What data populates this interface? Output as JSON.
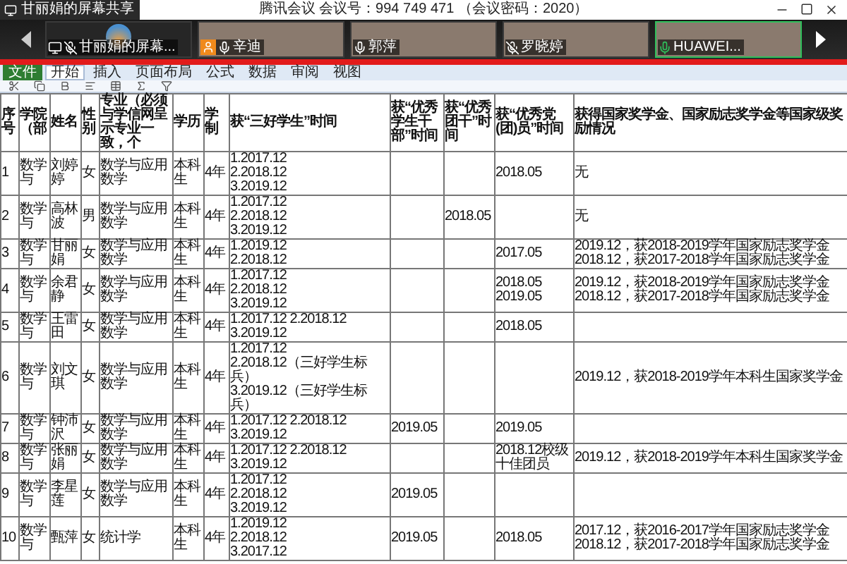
{
  "window": {
    "title": "腾讯会议 会议号：994 749 471 （会议密码：2020）"
  },
  "participants": [
    {
      "name": "甘丽娟的屏幕...",
      "kind": "screen",
      "muted": true,
      "speaking": false,
      "host": false
    },
    {
      "name": "辛迪",
      "kind": "video",
      "muted": false,
      "speaking": false,
      "host": true
    },
    {
      "name": "郭萍",
      "kind": "video",
      "muted": false,
      "speaking": false,
      "host": false
    },
    {
      "name": "罗晓婷",
      "kind": "video",
      "muted": true,
      "speaking": false,
      "host": false
    },
    {
      "name": "HUAWEI...",
      "kind": "video",
      "muted": false,
      "speaking": true,
      "host": false
    }
  ],
  "excel": {
    "tabs": [
      {
        "label": "文件",
        "kind": "file",
        "selected": false
      },
      {
        "label": "开始",
        "kind": "tab",
        "selected": true
      },
      {
        "label": "插入",
        "kind": "tab",
        "selected": false
      },
      {
        "label": "页面布局",
        "kind": "tab",
        "selected": false
      },
      {
        "label": "公式",
        "kind": "tab",
        "selected": false
      },
      {
        "label": "数据",
        "kind": "tab",
        "selected": false
      },
      {
        "label": "审阅",
        "kind": "tab",
        "selected": false
      },
      {
        "label": "视图",
        "kind": "tab",
        "selected": false
      }
    ],
    "table": {
      "columns": [
        "序号",
        "学院（部",
        "姓名",
        "性别",
        "专业（必须与学信网呈示专业一致，个",
        "学历",
        "学制",
        "获“三好学生”时间",
        "获“优秀学生干部”时间",
        "获“优秀团干”时间",
        "获“优秀党(团)员”时间",
        "获得国家奖学金、国家励志奖学金等国家级奖励情况"
      ],
      "rows": [
        [
          "1",
          "数学与",
          "刘婷婷",
          "女",
          "数学与应用数学",
          "本科生",
          "4年",
          "1.2017.12\n2.2018.12\n3.2019.12",
          null,
          null,
          "2018.05",
          "无"
        ],
        [
          "2",
          "数学与",
          "高林波",
          "男",
          "数学与应用数学",
          "本科生",
          "4年",
          "1.2017.12\n2.2018.12\n3.2019.12",
          null,
          "2018.05",
          null,
          "无"
        ],
        [
          "3",
          "数学与",
          "甘丽娟",
          "女",
          "数学与应用数学",
          "本科生",
          "4年",
          "1.2019.12\n2.2018.12",
          null,
          null,
          "2017.05",
          "2019.12，获2018-2019学年国家励志奖学金\n2018.12，获2017-2018学年国家励志奖学金"
        ],
        [
          "4",
          "数学与",
          "余君静",
          "女",
          "数学与应用数学",
          "本科生",
          "4年",
          "1.2017.12\n2.2018.12\n3.2019.12",
          null,
          null,
          "2018.05\n2019.05",
          "2019.12，获2018-2019学年国家励志奖学金\n2018.12，获2017-2018学年国家励志奖学金"
        ],
        [
          "5",
          "数学与",
          "王雷田",
          "女",
          "数学与应用数学",
          "本科生",
          "4年",
          "1.2017.12 2.2018.12\n3.2019.12",
          null,
          null,
          "2018.05",
          null
        ],
        [
          "6",
          "数学与",
          "刘文琪",
          "女",
          "数学与应用数学",
          "本科生",
          "4年",
          "1.2017.12\n2.2018.12（三好学生标兵）\n3.2019.12（三好学生标兵）",
          null,
          null,
          null,
          "2019.12，获2018-2019学年本科生国家奖学金"
        ],
        [
          "7",
          "数学与",
          "钟沛沢",
          "女",
          "数学与应用数学",
          "本科生",
          "4年",
          "1.2017.12 2.2018.12\n3.2019.12",
          "2019.05",
          null,
          "2019.05",
          null
        ],
        [
          "8",
          "数学与",
          "张丽娟",
          "女",
          "数学与应用数学",
          "本科生",
          "4年",
          "1.2017.12 2.2018.12\n3.2019.12",
          null,
          null,
          "2018.12校级十佳团员",
          "2019.12，获2018-2019学年本科生国家奖学金"
        ],
        [
          "9",
          "数学与",
          "李星莲",
          "女",
          "数学与应用数学",
          "本科生",
          "4年",
          "1.2017.12\n2.2018.12\n3.2019.12",
          "2019.05",
          null,
          null,
          null
        ],
        [
          "10",
          "数学与",
          "甄萍",
          "女",
          "统计学",
          "本科生",
          "4年",
          "1.2019.12\n2.2018.12\n3.2017.12",
          "2019.05",
          null,
          "2018.05",
          "2017.12，获2016-2017学年国家励志奖学金\n2018.12，获2017-2018学年国家励志奖学金"
        ]
      ]
    }
  },
  "share_label": "甘丽娟的屏幕共享"
}
